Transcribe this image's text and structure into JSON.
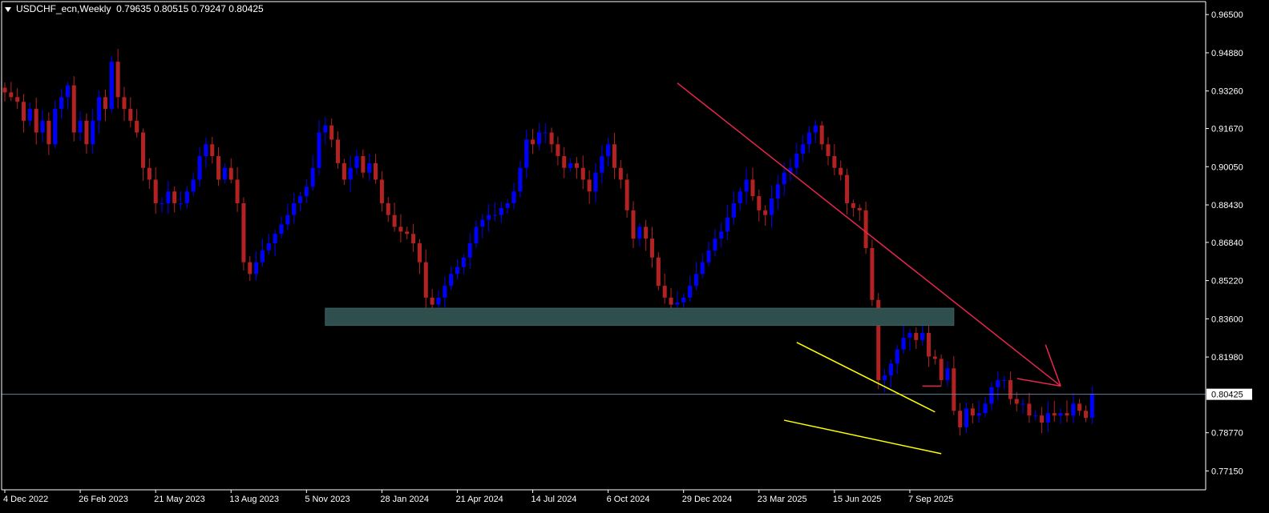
{
  "header": {
    "symbol": "USDCHF_ecn,Weekly",
    "ohlc": "0.79635 0.80515 0.79247 0.80425"
  },
  "colors": {
    "background": "#000000",
    "bull": "#0000ff",
    "bear": "#b22222",
    "axis": "#ffffff",
    "zone": "#2f4f4f",
    "trend_arrow": "#e8264a",
    "wedge": "#ffff00",
    "resistance": "#e8264a",
    "price_line": "#6b7c99"
  },
  "chart_data": {
    "type": "candlestick",
    "timeframe": "Weekly",
    "ylim": [
      0.7635,
      0.9705
    ],
    "price_axis_ticks": [
      "0.96500",
      "0.94880",
      "0.93260",
      "0.91670",
      "0.90050",
      "0.88430",
      "0.86840",
      "0.85220",
      "0.83600",
      "0.81980",
      "0.78770",
      "0.77150"
    ],
    "current_price_label": "0.80425",
    "date_axis_ticks": [
      "4 Dec 2022",
      "26 Feb 2023",
      "21 May 2023",
      "13 Aug 2023",
      "5 Nov 2023",
      "28 Jan 2024",
      "21 Apr 2024",
      "14 Jul 2024",
      "6 Oct 2024",
      "29 Dec 2024",
      "23 Mar 2025",
      "15 Jun 2025",
      "7 Sep 2025"
    ],
    "x_start": "4 Dec 2022",
    "bar_interval_days": 7,
    "closes": [
      0.932,
      0.93,
      0.928,
      0.92,
      0.925,
      0.915,
      0.92,
      0.91,
      0.925,
      0.93,
      0.935,
      0.915,
      0.92,
      0.91,
      0.92,
      0.93,
      0.925,
      0.945,
      0.93,
      0.925,
      0.92,
      0.915,
      0.9,
      0.895,
      0.885,
      0.885,
      0.89,
      0.885,
      0.885,
      0.89,
      0.895,
      0.905,
      0.91,
      0.905,
      0.895,
      0.9,
      0.895,
      0.885,
      0.86,
      0.855,
      0.86,
      0.865,
      0.868,
      0.872,
      0.876,
      0.88,
      0.885,
      0.888,
      0.892,
      0.9,
      0.915,
      0.918,
      0.912,
      0.902,
      0.895,
      0.9,
      0.905,
      0.898,
      0.902,
      0.895,
      0.885,
      0.88,
      0.875,
      0.873,
      0.872,
      0.868,
      0.86,
      0.845,
      0.842,
      0.845,
      0.85,
      0.855,
      0.858,
      0.862,
      0.868,
      0.875,
      0.878,
      0.88,
      0.88,
      0.883,
      0.885,
      0.89,
      0.9,
      0.912,
      0.91,
      0.915,
      0.915,
      0.91,
      0.905,
      0.9,
      0.902,
      0.9,
      0.895,
      0.89,
      0.898,
      0.905,
      0.91,
      0.9,
      0.895,
      0.882,
      0.87,
      0.875,
      0.87,
      0.862,
      0.85,
      0.845,
      0.842,
      0.843,
      0.845,
      0.85,
      0.855,
      0.86,
      0.865,
      0.87,
      0.873,
      0.879,
      0.885,
      0.89,
      0.895,
      0.888,
      0.882,
      0.88,
      0.887,
      0.893,
      0.898,
      0.9,
      0.906,
      0.91,
      0.915,
      0.918,
      0.91,
      0.905,
      0.9,
      0.897,
      0.885,
      0.883,
      0.882,
      0.866,
      0.844,
      0.81,
      0.812,
      0.817,
      0.823,
      0.828,
      0.83,
      0.827,
      0.83,
      0.82,
      0.819,
      0.81,
      0.815,
      0.797,
      0.79,
      0.798,
      0.795,
      0.796,
      0.8,
      0.807,
      0.81,
      0.81,
      0.802,
      0.8,
      0.8,
      0.795,
      0.795,
      0.792,
      0.796,
      0.795,
      0.796,
      0.795,
      0.8,
      0.797,
      0.794,
      0.804
    ],
    "zone": {
      "label_dates": [
        "26 Nov 2023",
        "26 Oct 2025"
      ],
      "price_top": 0.8405,
      "price_bottom": 0.8332
    },
    "trend_arrow": {
      "from": {
        "date": "22 Dec 2024",
        "price": 0.936
      },
      "to": {
        "date": "22 Feb 2026",
        "price": 0.8075
      }
    },
    "wedge_upper": {
      "from": {
        "date": "4 May 2025",
        "price": 0.826
      },
      "to": {
        "date": "5 Oct 2025",
        "price": 0.7965
      }
    },
    "wedge_lower": {
      "from": {
        "date": "20 Apr 2025",
        "price": 0.793
      },
      "to": {
        "date": "12 Oct 2025",
        "price": 0.7788
      }
    },
    "resistance": {
      "from": {
        "date": "21 Sep 2025"
      },
      "to": {
        "date": "12 Oct 2025"
      },
      "price": 0.8075
    }
  }
}
